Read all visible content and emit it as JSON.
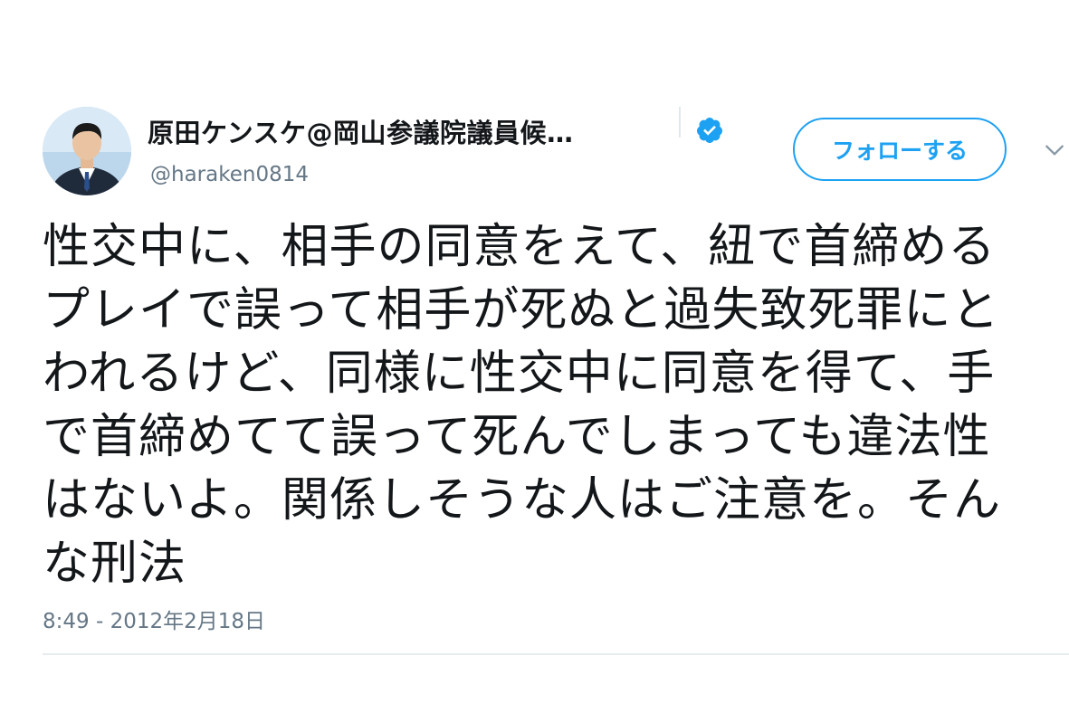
{
  "author": {
    "display_name": "原田ケンスケ@岡山参議院議員候…",
    "handle": "@haraken0814",
    "verified_icon": "verified-badge-icon",
    "avatar_icon": "profile-photo"
  },
  "follow_button": {
    "label": "フォローする"
  },
  "menu_icon": "chevron-down-icon",
  "tweet": {
    "text": "性交中に、相手の同意をえて、紐で首締める\nプレイで誤って相手が死ぬと過失致死罪にと\nわれるけど、同様に性交中に同意を得て、手\nで首締めてて誤って死んでしまっても違法性\nはないよ。関係しそうな人はご注意を。そん\nな刑法",
    "timestamp": "8:49 - 2012年2月18日"
  },
  "colors": {
    "accent": "#1da1f2",
    "text_primary": "#14171a",
    "text_secondary": "#657786",
    "divider": "#e6ecf0"
  }
}
